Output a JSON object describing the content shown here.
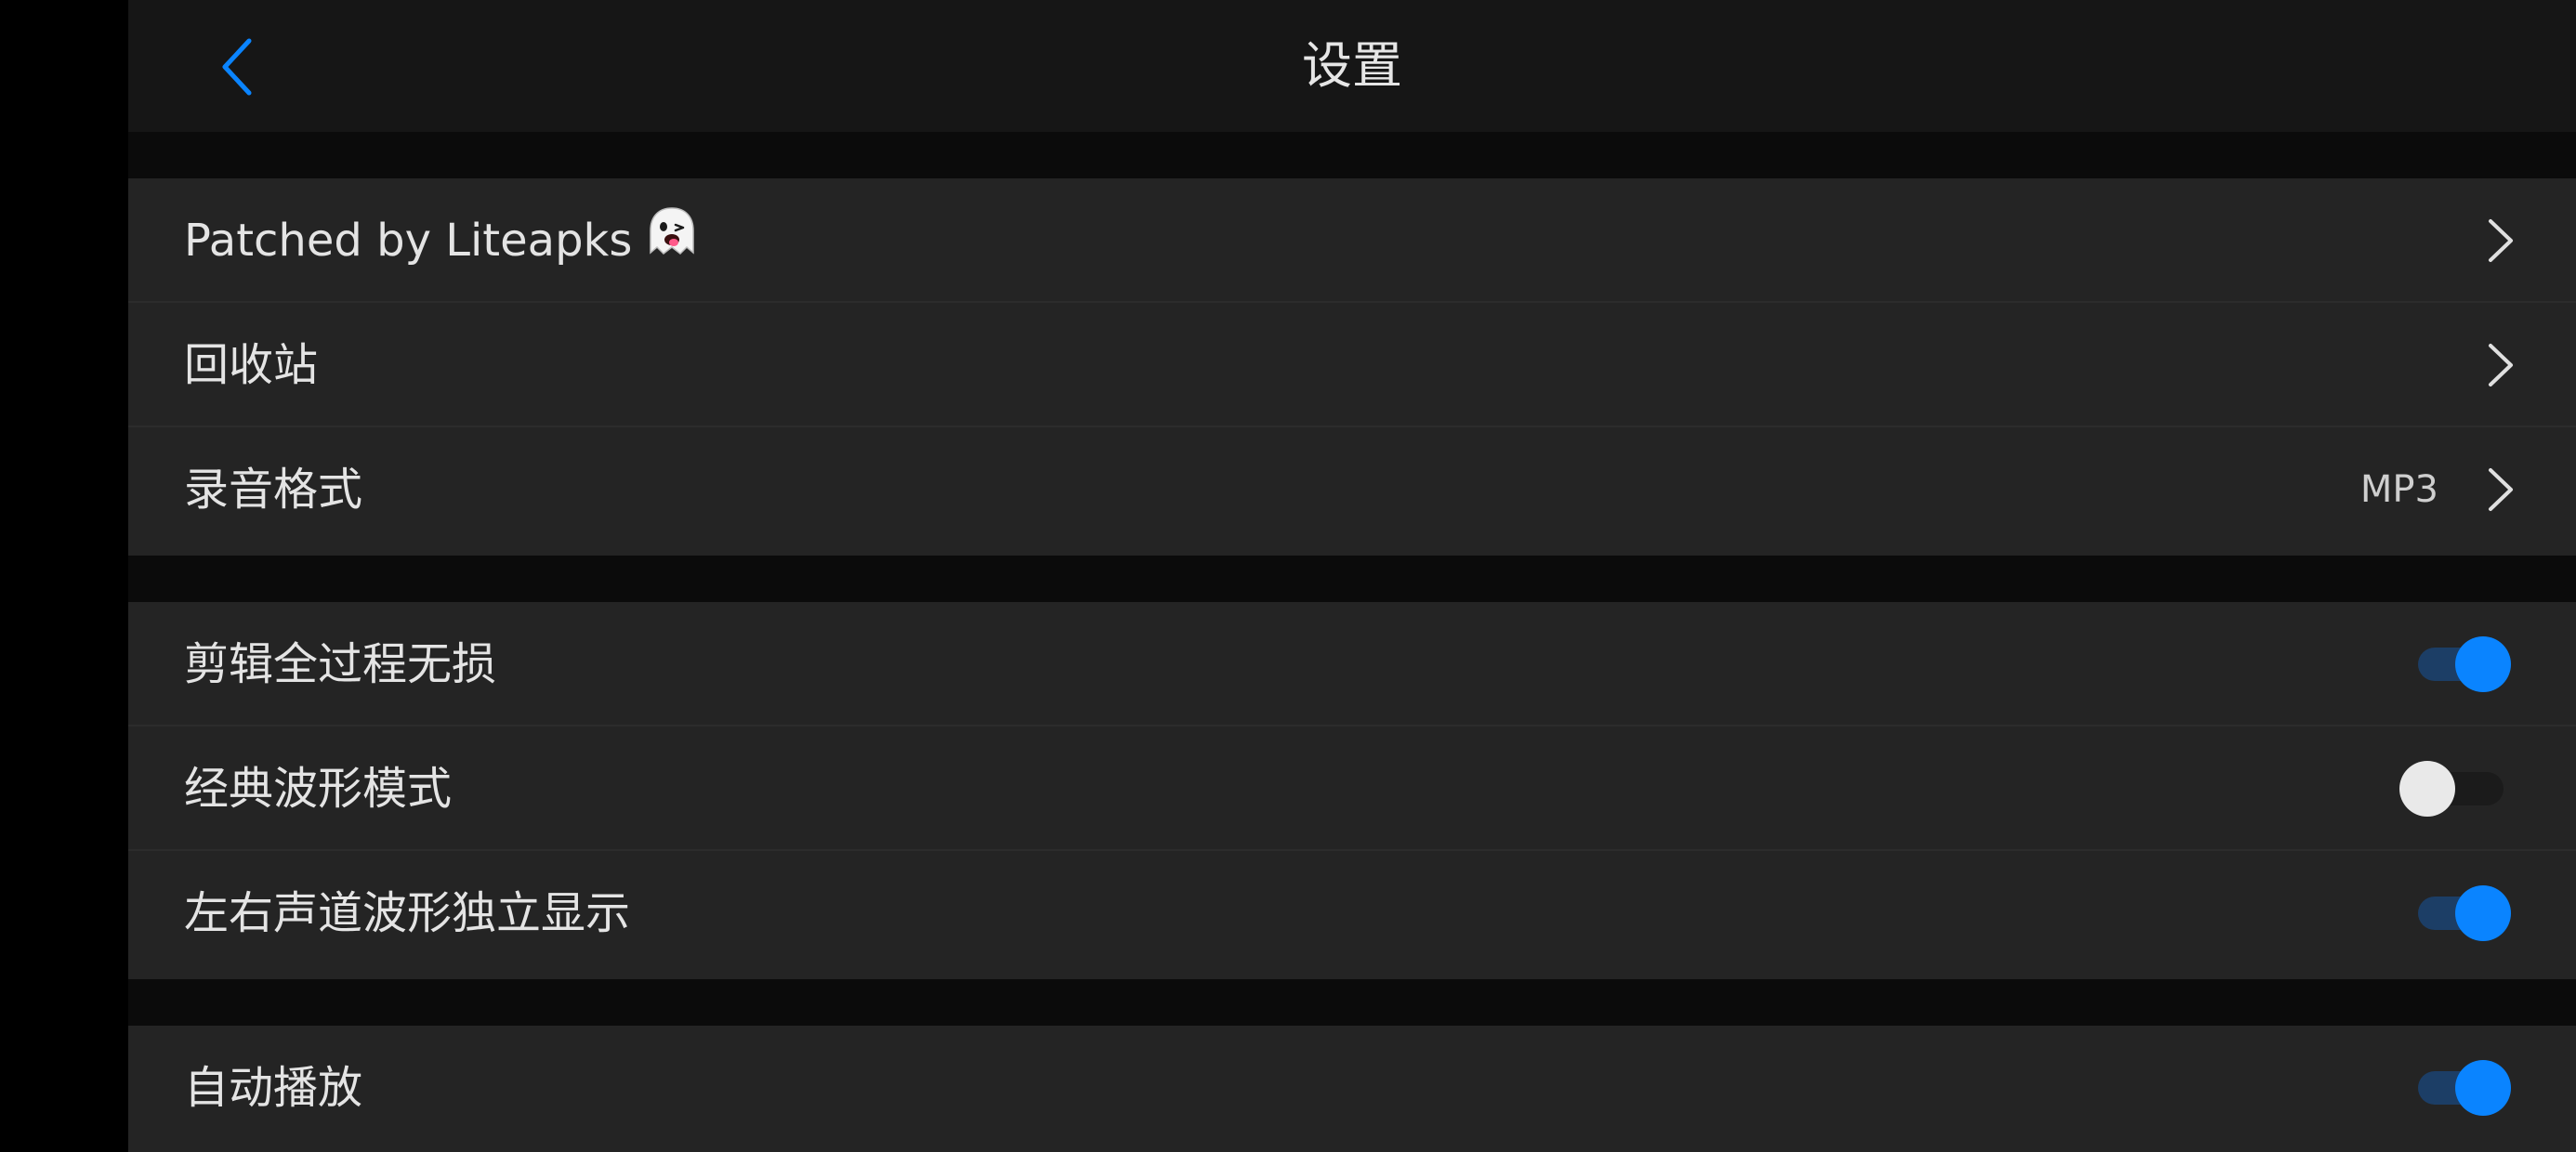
{
  "header": {
    "title": "设置",
    "back_icon": "chevron-left-icon"
  },
  "colors": {
    "accent": "#0A84FF",
    "toggle_track_on": "#1C3E66",
    "row_background": "#242424",
    "header_background": "#161616",
    "separator_background": "#0B0B0B"
  },
  "groups": [
    {
      "rows": [
        {
          "label": "Patched by Liteapks",
          "emoji": "ghost-emoji",
          "control": "chevron"
        },
        {
          "label": "回收站",
          "control": "chevron"
        },
        {
          "label": "录音格式",
          "value": "MP3",
          "control": "chevron"
        }
      ]
    },
    {
      "rows": [
        {
          "label": "剪辑全过程无损",
          "control": "toggle",
          "on": true
        },
        {
          "label": "经典波形模式",
          "control": "toggle",
          "on": false
        },
        {
          "label": "左右声道波形独立显示",
          "control": "toggle",
          "on": true
        }
      ]
    },
    {
      "rows": [
        {
          "label": "自动播放",
          "control": "toggle",
          "on": true
        }
      ]
    }
  ]
}
